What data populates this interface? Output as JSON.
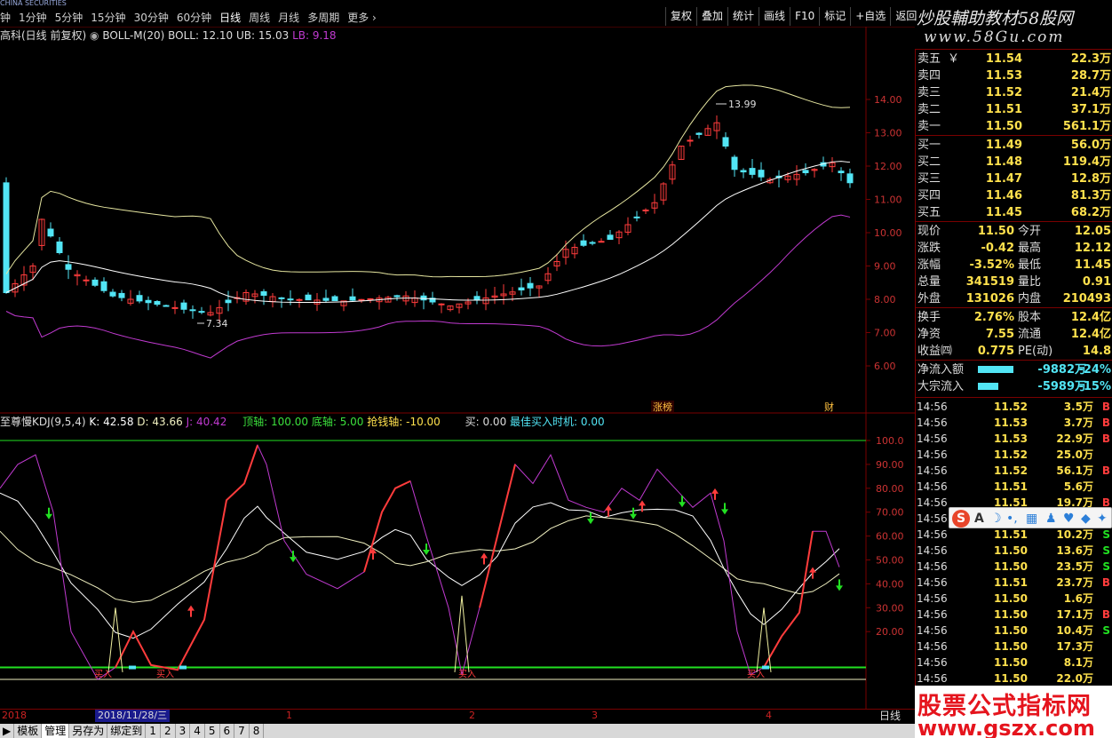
{
  "broker_strip": "CHINA SECURITIES",
  "periods": [
    "1分钟",
    "5分钟",
    "15分钟",
    "30分钟",
    "60分钟",
    "日线",
    "周线",
    "月线",
    "多周期",
    "更多"
  ],
  "period_prefix": "钟",
  "active_period": "日线",
  "tools": [
    "复权",
    "叠加",
    "统计",
    "画线",
    "F10",
    "标记",
    "+自选",
    "返回"
  ],
  "watermark": {
    "line1": "炒股輔助教材58股网",
    "line2": "www.58Gu.com",
    "bottom1": "股票公式指标网",
    "bottom2": "www.gszx.com"
  },
  "main_legend": {
    "stock_name": "高科(日线 前复权)",
    "indicator": "BOLL-M(20)",
    "boll": "BOLL: 12.10",
    "ub": "UB: 15.03",
    "lb": "LB: 9.18"
  },
  "price_axis": [
    "14.00",
    "13.00",
    "12.00",
    "11.00",
    "10.00",
    "9.00",
    "8.00",
    "7.00",
    "6.00"
  ],
  "annotations": {
    "high": "13.99",
    "low": "7.34",
    "tag1": "涨榜",
    "tag2": "财"
  },
  "kdj_legend": {
    "name": "至尊慢KDJ(9,5,4)",
    "k": "K: 42.58",
    "d": "D: 43.66",
    "j": "J: 40.42",
    "top": "顶轴: 100.00",
    "bottom": "底轴: 5.00",
    "grab": "抢钱轴: -10.00",
    "buy": "买: 0.00",
    "best": "最佳买入时机: 0.00"
  },
  "kdj_axis": [
    "100.0",
    "90.00",
    "80.00",
    "70.00",
    "60.00",
    "50.00",
    "40.00",
    "30.00",
    "20.00"
  ],
  "kdj_labels": [
    "买入",
    "买入",
    "买入",
    "买入"
  ],
  "sell": [
    {
      "label": "卖五",
      "price": "11.54",
      "vol": "22.3万"
    },
    {
      "label": "卖四",
      "price": "11.53",
      "vol": "28.7万"
    },
    {
      "label": "卖三",
      "price": "11.52",
      "vol": "21.4万"
    },
    {
      "label": "卖二",
      "price": "11.51",
      "vol": "37.1万"
    },
    {
      "label": "卖一",
      "price": "11.50",
      "vol": "561.1万"
    }
  ],
  "buy": [
    {
      "label": "买一",
      "price": "11.49",
      "vol": "56.0万"
    },
    {
      "label": "买二",
      "price": "11.48",
      "vol": "119.4万"
    },
    {
      "label": "买三",
      "price": "11.47",
      "vol": "12.8万"
    },
    {
      "label": "买四",
      "price": "11.46",
      "vol": "81.3万"
    },
    {
      "label": "买五",
      "price": "11.45",
      "vol": "68.2万"
    }
  ],
  "sell_mark": "￥",
  "stats": [
    {
      "l1": "现价",
      "v1": "11.50",
      "l2": "今开",
      "v2": "12.05"
    },
    {
      "l1": "涨跌",
      "v1": "-0.42",
      "l2": "最高",
      "v2": "12.12"
    },
    {
      "l1": "涨幅",
      "v1": "-3.52%",
      "l2": "最低",
      "v2": "11.45"
    },
    {
      "l1": "总量",
      "v1": "341519",
      "l2": "量比",
      "v2": "0.91"
    },
    {
      "l1": "外盘",
      "v1": "131026",
      "l2": "内盘",
      "v2": "210493"
    }
  ],
  "stats2": [
    {
      "l1": "换手",
      "v1": "2.76%",
      "l2": "股本",
      "v2": "12.4亿"
    },
    {
      "l1": "净资",
      "v1": "7.55",
      "l2": "流通",
      "v2": "12.4亿"
    },
    {
      "l1": "收益㈣",
      "v1": "0.775",
      "l2": "PE(动)",
      "v2": "14.8"
    }
  ],
  "flows": [
    {
      "label": "净流入额",
      "value": "-9882万",
      "pct": "-24%",
      "bar": 0.8
    },
    {
      "label": "大宗流入",
      "value": "-5989万",
      "pct": "-15%",
      "bar": 0.45
    }
  ],
  "ticks": [
    {
      "t": "14:56",
      "p": "11.52",
      "v": "3.5万",
      "s": "B"
    },
    {
      "t": "14:56",
      "p": "11.53",
      "v": "3.7万",
      "s": "B"
    },
    {
      "t": "14:56",
      "p": "11.53",
      "v": "22.9万",
      "s": "B"
    },
    {
      "t": "14:56",
      "p": "11.52",
      "v": "25.0万",
      "s": ""
    },
    {
      "t": "14:56",
      "p": "11.52",
      "v": "56.1万",
      "s": "B"
    },
    {
      "t": "14:56",
      "p": "11.51",
      "v": "5.6万",
      "s": ""
    },
    {
      "t": "14:56",
      "p": "11.51",
      "v": "19.7万",
      "s": "B"
    },
    {
      "t": "14:56",
      "p": "11.50",
      "v": "",
      "s": ""
    },
    {
      "t": "14:56",
      "p": "11.51",
      "v": "10.2万",
      "s": "S"
    },
    {
      "t": "14:56",
      "p": "11.50",
      "v": "13.6万",
      "s": "S"
    },
    {
      "t": "14:56",
      "p": "11.50",
      "v": "23.5万",
      "s": "S"
    },
    {
      "t": "14:56",
      "p": "11.51",
      "v": "23.7万",
      "s": "B"
    },
    {
      "t": "14:56",
      "p": "11.50",
      "v": "1.6万",
      "s": ""
    },
    {
      "t": "14:56",
      "p": "11.50",
      "v": "17.1万",
      "s": "B"
    },
    {
      "t": "14:56",
      "p": "11.50",
      "v": "10.4万",
      "s": "S"
    },
    {
      "t": "14:56",
      "p": "11.50",
      "v": "17.3万",
      "s": ""
    },
    {
      "t": "14:56",
      "p": "11.50",
      "v": "8.1万",
      "s": ""
    },
    {
      "t": "14:56",
      "p": "11.50",
      "v": "22.0万",
      "s": ""
    }
  ],
  "date_axis": {
    "current": "2018/11/28/三",
    "year_mark": "2018",
    "marks": [
      "1",
      "2",
      "3",
      "4"
    ],
    "right": "日线"
  },
  "bottom_tabs": [
    "▶",
    "模板",
    "管理",
    "另存为",
    "绑定到",
    "1",
    "2",
    "3",
    "4",
    "5",
    "6",
    "7",
    "8"
  ],
  "colors": {
    "up": "#ff3c3c",
    "down": "#52e5f5",
    "ub": "#e6e6a0",
    "mid": "#ffffff",
    "lb": "#c03ad0",
    "k": "#ffffff",
    "d": "#f0f0c0",
    "j": "#c03ad0",
    "green": "#22e022"
  }
}
